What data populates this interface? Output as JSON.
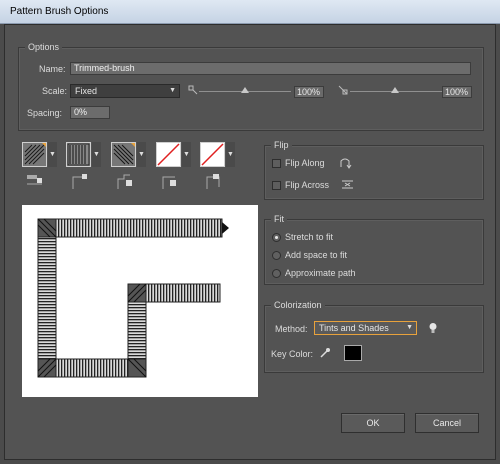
{
  "window": {
    "title": "Pattern Brush Options"
  },
  "options": {
    "group_label": "Options",
    "name_label": "Name:",
    "name_value": "Trimmed-brush",
    "scale_label": "Scale:",
    "scale_mode": "Fixed",
    "scale_min_value": "100%",
    "scale_max_value": "100%",
    "spacing_label": "Spacing:",
    "spacing_value": "0%"
  },
  "flip": {
    "group_label": "Flip",
    "along_label": "Flip Along",
    "across_label": "Flip Across",
    "along_checked": false,
    "across_checked": false
  },
  "fit": {
    "group_label": "Fit",
    "options": [
      "Stretch to fit",
      "Add space to fit",
      "Approximate path"
    ],
    "selected": "Stretch to fit"
  },
  "colorization": {
    "group_label": "Colorization",
    "method_label": "Method:",
    "method_value": "Tints and Shades",
    "key_color_label": "Key Color:",
    "key_color": "#000000"
  },
  "tiles": [
    {
      "name": "outer-corner-tile",
      "state": "pattern"
    },
    {
      "name": "side-tile",
      "state": "pattern"
    },
    {
      "name": "inner-corner-tile",
      "state": "pattern"
    },
    {
      "name": "start-tile",
      "state": "none"
    },
    {
      "name": "end-tile",
      "state": "none"
    }
  ],
  "buttons": {
    "ok": "OK",
    "cancel": "Cancel"
  },
  "colors": {
    "accent": "#e8a23c",
    "none_slash": "#e02020",
    "dialog_bg": "#535353"
  }
}
